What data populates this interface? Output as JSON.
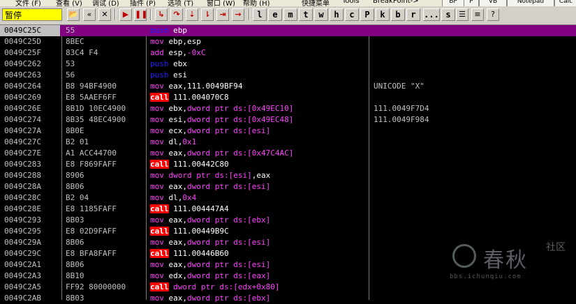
{
  "menu": {
    "items": [
      "文件 (F)",
      "查看 (V)",
      "调试 (D)",
      "插件 (P)",
      "选项 (T)",
      "窗口 (W)",
      "帮助 (H)",
      "快捷菜单",
      "Tools",
      "BreakPoint->"
    ],
    "right_buttons": [
      "BP",
      "P",
      "VB",
      "Notepad",
      "Calc"
    ]
  },
  "toolbar": {
    "status_label": "暂停",
    "letters": [
      "l",
      "e",
      "m",
      "t",
      "w",
      "h",
      "c",
      "P",
      "k",
      "b",
      "r",
      "...",
      "s"
    ]
  },
  "colors": {
    "selected_row": "#800080",
    "mnemonic_push": "#2020ff",
    "mnemonic_mov": "#ff40ff",
    "call_bg": "#ff0000"
  },
  "rows": [
    {
      "addr": "0049C25C",
      "hex": "55",
      "mn": "push",
      "ops": [
        [
          "ebp",
          "op"
        ]
      ],
      "comment": "",
      "selected": true
    },
    {
      "addr": "0049C25D",
      "hex": "8BEC",
      "mn": "mov",
      "ops": [
        [
          "ebp,esp",
          "op"
        ]
      ],
      "comment": ""
    },
    {
      "addr": "0049C25F",
      "hex": "83C4 F4",
      "mn": "add",
      "ops": [
        [
          "esp,",
          "op"
        ],
        [
          "-0xC",
          "op-mem"
        ]
      ],
      "comment": ""
    },
    {
      "addr": "0049C262",
      "hex": "53",
      "mn": "push",
      "ops": [
        [
          "ebx",
          "op"
        ]
      ],
      "comment": ""
    },
    {
      "addr": "0049C263",
      "hex": "56",
      "mn": "push",
      "ops": [
        [
          "esi",
          "op"
        ]
      ],
      "comment": ""
    },
    {
      "addr": "0049C264",
      "hex": "B8 94BF4900",
      "mn": "mov",
      "ops": [
        [
          "eax,111.0049BF94",
          "op"
        ]
      ],
      "comment": "UNICODE \"X\""
    },
    {
      "addr": "0049C269",
      "hex": "E8 5AAEF6FF",
      "mn": "call",
      "ops": [
        [
          "111.004070C8",
          "op"
        ]
      ],
      "comment": ""
    },
    {
      "addr": "0049C26E",
      "hex": "8B1D 10EC4900",
      "mn": "mov",
      "ops": [
        [
          "ebx,",
          "op"
        ],
        [
          "dword ptr ds:[0x49EC10]",
          "op-mem"
        ]
      ],
      "comment": "111.0049F7D4"
    },
    {
      "addr": "0049C274",
      "hex": "8B35 48EC4900",
      "mn": "mov",
      "ops": [
        [
          "esi,",
          "op"
        ],
        [
          "dword ptr ds:[0x49EC48]",
          "op-mem"
        ]
      ],
      "comment": "111.0049F984"
    },
    {
      "addr": "0049C27A",
      "hex": "8B0E",
      "mn": "mov",
      "ops": [
        [
          "ecx,",
          "op"
        ],
        [
          "dword ptr ds:[esi]",
          "op-mem"
        ]
      ],
      "comment": ""
    },
    {
      "addr": "0049C27C",
      "hex": "B2 01",
      "mn": "mov",
      "ops": [
        [
          "dl,",
          "op"
        ],
        [
          "0x1",
          "op-mem"
        ]
      ],
      "comment": ""
    },
    {
      "addr": "0049C27E",
      "hex": "A1 ACC44700",
      "mn": "mov",
      "ops": [
        [
          "eax,",
          "op"
        ],
        [
          "dword ptr ds:[0x47C4AC]",
          "op-mem"
        ]
      ],
      "comment": ""
    },
    {
      "addr": "0049C283",
      "hex": "E8 F869FAFF",
      "mn": "call",
      "ops": [
        [
          "111.00442C80",
          "op"
        ]
      ],
      "comment": ""
    },
    {
      "addr": "0049C288",
      "hex": "8906",
      "mn": "mov",
      "ops": [
        [
          "dword ptr ds:[esi]",
          "op-mem"
        ],
        [
          ",eax",
          "op"
        ]
      ],
      "comment": ""
    },
    {
      "addr": "0049C28A",
      "hex": "8B06",
      "mn": "mov",
      "ops": [
        [
          "eax,",
          "op"
        ],
        [
          "dword ptr ds:[esi]",
          "op-mem"
        ]
      ],
      "comment": ""
    },
    {
      "addr": "0049C28C",
      "hex": "B2 04",
      "mn": "mov",
      "ops": [
        [
          "dl,",
          "op"
        ],
        [
          "0x4",
          "op-mem"
        ]
      ],
      "comment": ""
    },
    {
      "addr": "0049C28E",
      "hex": "E8 1185FAFF",
      "mn": "call",
      "ops": [
        [
          "111.004447A4",
          "op"
        ]
      ],
      "comment": ""
    },
    {
      "addr": "0049C293",
      "hex": "8B03",
      "mn": "mov",
      "ops": [
        [
          "eax,",
          "op"
        ],
        [
          "dword ptr ds:[ebx]",
          "op-mem"
        ]
      ],
      "comment": ""
    },
    {
      "addr": "0049C295",
      "hex": "E8 02D9FAFF",
      "mn": "call",
      "ops": [
        [
          "111.00449B9C",
          "op"
        ]
      ],
      "comment": ""
    },
    {
      "addr": "0049C29A",
      "hex": "8B06",
      "mn": "mov",
      "ops": [
        [
          "eax,",
          "op"
        ],
        [
          "dword ptr ds:[esi]",
          "op-mem"
        ]
      ],
      "comment": ""
    },
    {
      "addr": "0049C29C",
      "hex": "E8 BFA8FAFF",
      "mn": "call",
      "ops": [
        [
          "111.00446B60",
          "op"
        ]
      ],
      "comment": ""
    },
    {
      "addr": "0049C2A1",
      "hex": "8B06",
      "mn": "mov",
      "ops": [
        [
          "eax,",
          "op"
        ],
        [
          "dword ptr ds:[esi]",
          "op-mem"
        ]
      ],
      "comment": ""
    },
    {
      "addr": "0049C2A3",
      "hex": "8B10",
      "mn": "mov",
      "ops": [
        [
          "edx,",
          "op"
        ],
        [
          "dword ptr ds:[eax]",
          "op-mem"
        ]
      ],
      "comment": ""
    },
    {
      "addr": "0049C2A5",
      "hex": "FF92 80000000",
      "mn": "call",
      "ops": [
        [
          "dword ptr ds:[edx+0x80]",
          "op-mem"
        ]
      ],
      "comment": ""
    },
    {
      "addr": "0049C2AB",
      "hex": "8B03",
      "mn": "mov",
      "ops": [
        [
          "eax,",
          "op"
        ],
        [
          "dword ptr ds:[ebx]",
          "op-mem"
        ]
      ],
      "comment": ""
    }
  ],
  "watermark": {
    "brand": "春秋",
    "side": "社区",
    "url": "bbs.ichunqiu.com"
  }
}
